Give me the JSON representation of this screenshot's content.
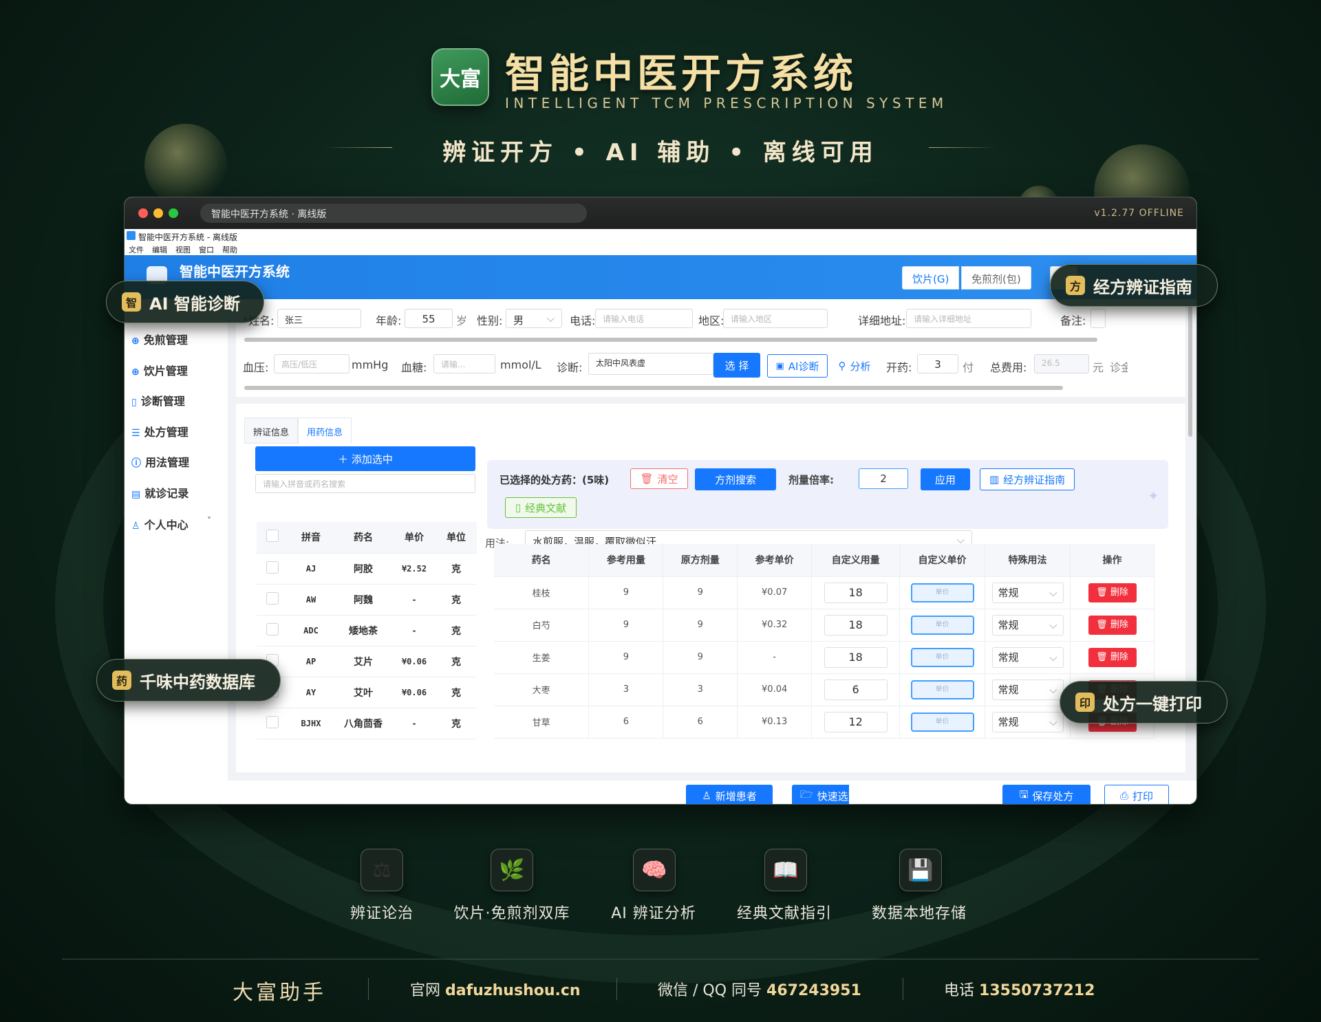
{
  "header": {
    "logo_text": "大富",
    "title": "智能中医开方系统",
    "subtitle": "INTELLIGENT TCM PRESCRIPTION SYSTEM",
    "slogan": "辨证开方 • AI 辅助 • 离线可用"
  },
  "window": {
    "tab_title": "智能中医开方系统 · 离线版",
    "version": "v1.2.77 OFFLINE",
    "os_title": "智能中医开方系统 - 离线版",
    "menu": [
      "文件",
      "编辑",
      "视图",
      "窗口",
      "帮助"
    ],
    "app_title": "智能中医开方系统",
    "mode_tabs": [
      "饮片(G)",
      "免煎剂(包)"
    ]
  },
  "sidebar": {
    "items": [
      "免煎管理",
      "饮片管理",
      "诊断管理",
      "处方管理",
      "用法管理",
      "就诊记录",
      "个人中心"
    ]
  },
  "form": {
    "name_label": "*姓名:",
    "name_value": "张三",
    "age_label": "年龄:",
    "age_value": "55",
    "age_unit": "岁",
    "gender_label": "性别:",
    "gender_value": "男",
    "phone_label": "电话:",
    "phone_placeholder": "请输入电话",
    "region_label": "地区:",
    "region_placeholder": "请输入地区",
    "address_label": "详细地址:",
    "address_placeholder": "请输入详细地址",
    "note_label": "备注:",
    "bp_label": "血压:",
    "bp_placeholder": "高压/低压",
    "bp_unit": "mmHg",
    "sugar_label": "血糖:",
    "sugar_placeholder": "请输...",
    "sugar_unit": "mmol/L",
    "diag_label": "诊断:",
    "diag_value": "太阳中风表虚",
    "select_btn": "选 择",
    "ai_btn": "AI诊断",
    "analyze_btn": "分析",
    "dose_label": "开药:",
    "dose_value": "3",
    "dose_unit": "付",
    "fee_label": "总费用:",
    "fee_value": "26.5",
    "fee_unit": "元",
    "extra_label": "诊⾦"
  },
  "tabs": [
    "辨证信息",
    "用药信息"
  ],
  "left": {
    "add_btn": "＋ 添加选中",
    "search_placeholder": "请输入拼音或药名搜索",
    "columns": [
      "拼音",
      "药名",
      "单价",
      "单位"
    ],
    "rows": [
      {
        "py": "AJ",
        "name": "阿胶",
        "price": "¥2.52",
        "unit": "克"
      },
      {
        "py": "AW",
        "name": "阿魏",
        "price": "-",
        "unit": "克"
      },
      {
        "py": "ADC",
        "name": "矮地茶",
        "price": "-",
        "unit": "克"
      },
      {
        "py": "AP",
        "name": "艾片",
        "price": "¥0.06",
        "unit": "克"
      },
      {
        "py": "AY",
        "name": "艾叶",
        "price": "¥0.06",
        "unit": "克"
      },
      {
        "py": "BJHX",
        "name": "八角茴香",
        "price": "-",
        "unit": "克"
      }
    ]
  },
  "panel": {
    "selected_label": "已选择的处方药：(5味)",
    "clear_btn": "清空",
    "formula_search_btn": "方剂搜索",
    "ratio_label": "剂量倍率:",
    "ratio_value": "2",
    "apply_btn": "应用",
    "guide_btn": "经方辨证指南",
    "classic_btn": "经典文献",
    "usage_label": "用法:",
    "usage_value": "水煎服，温服，覆取微似汗"
  },
  "rx": {
    "columns": [
      "药名",
      "参考用量",
      "原方剂量",
      "参考单价",
      "自定义用量",
      "自定义单价",
      "特殊用法",
      "操作"
    ],
    "price_placeholder": "单价",
    "delete_label": "删除",
    "rows": [
      {
        "name": "桂枝",
        "ref": "9",
        "orig": "9",
        "price": "¥0.07",
        "qty": "18",
        "usage": "常规"
      },
      {
        "name": "白芍",
        "ref": "9",
        "orig": "9",
        "price": "¥0.32",
        "qty": "18",
        "usage": "常规"
      },
      {
        "name": "生姜",
        "ref": "9",
        "orig": "9",
        "price": "-",
        "qty": "18",
        "usage": "常规"
      },
      {
        "name": "大枣",
        "ref": "3",
        "orig": "3",
        "price": "¥0.04",
        "qty": "6",
        "usage": "常规"
      },
      {
        "name": "甘草",
        "ref": "6",
        "orig": "6",
        "price": "¥0.13",
        "qty": "12",
        "usage": "常规"
      }
    ]
  },
  "bottom": {
    "new_patient": "新增患者",
    "quick_select": "快速选方",
    "save": "保存处方",
    "print": "打印"
  },
  "pills": [
    {
      "icon": "智",
      "label": "AI 智能诊断"
    },
    {
      "icon": "方",
      "label": "经方辨证指南"
    },
    {
      "icon": "药",
      "label": "千味中药数据库"
    },
    {
      "icon": "印",
      "label": "处方一键打印"
    }
  ],
  "features": [
    {
      "icon": "scales-icon",
      "glyph": "⚖",
      "label": "辨证论治"
    },
    {
      "icon": "herb-leaf-icon",
      "glyph": "🌿",
      "label": "饮片·免煎剂双库"
    },
    {
      "icon": "brain-icon",
      "glyph": "🧠",
      "label": "AI 辨证分析"
    },
    {
      "icon": "book-icon",
      "glyph": "📖",
      "label": "经典文献指引"
    },
    {
      "icon": "floppy-disk-icon",
      "glyph": "💾",
      "label": "数据本地存储"
    }
  ],
  "footer": {
    "brand": "大富助手",
    "site_label": "官网",
    "site": "dafuzhushou.cn",
    "contact_label": "微信 / QQ 同号",
    "contact": "467243951",
    "phone_label": "电话",
    "phone": "13550737212"
  }
}
